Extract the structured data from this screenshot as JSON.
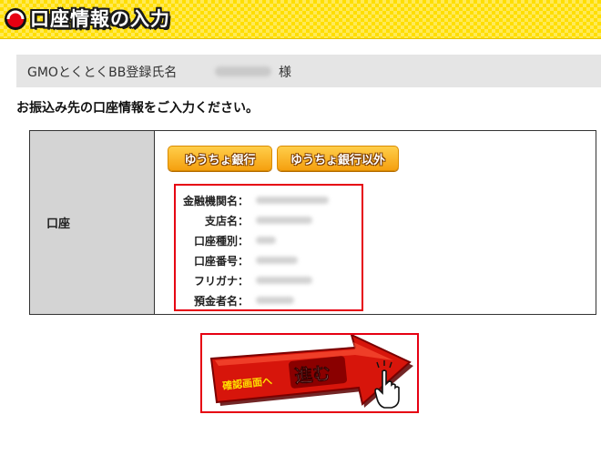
{
  "header": {
    "title": "口座情報の入力",
    "icon": "logo-arc-icon",
    "color": "#ffde00"
  },
  "registrant": {
    "label": "GMOとくとくBB登録氏名",
    "value_masked": "",
    "suffix": "様"
  },
  "instruction": "お振込み先の口座情報をご入力ください。",
  "account": {
    "header": "口座",
    "buttons": {
      "yucho": "ゆうちょ銀行",
      "other": "ゆうちょ銀行以外"
    },
    "fields": [
      {
        "label": "金融機関名：",
        "value": ""
      },
      {
        "label": "支店名：",
        "value": ""
      },
      {
        "label": "口座種別：",
        "value": ""
      },
      {
        "label": "口座番号：",
        "value": ""
      },
      {
        "label": "フリガナ：",
        "value": ""
      },
      {
        "label": "預金者名：",
        "value": ""
      }
    ]
  },
  "proceed": {
    "prefix": "確認画面へ",
    "main": "進む",
    "icons": [
      "arrow-icon",
      "hand-pointer-icon"
    ],
    "colors": {
      "arrow": "#d7150b",
      "highlight": "#e60012",
      "text_yellow": "#ffe100"
    }
  }
}
